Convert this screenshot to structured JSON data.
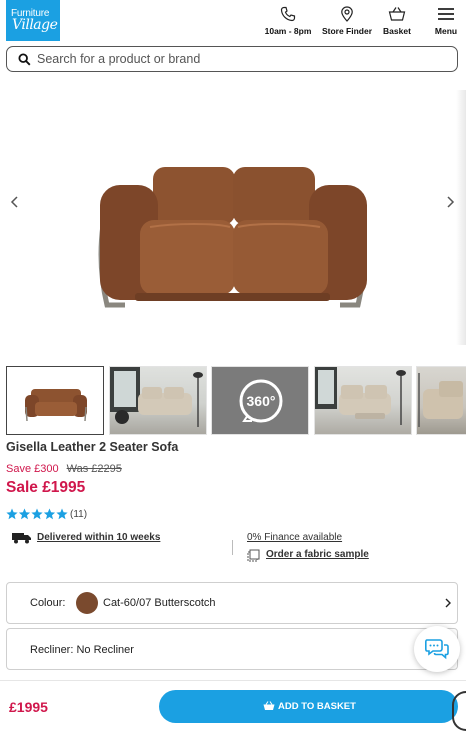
{
  "header": {
    "logo_line1": "Furniture",
    "logo_line2": "Village",
    "nav": [
      {
        "label": "10am - 8pm",
        "icon": "phone-icon"
      },
      {
        "label": "Store Finder",
        "icon": "location-pin-icon"
      },
      {
        "label": "Basket",
        "icon": "basket-icon"
      },
      {
        "label": "Menu",
        "icon": "hamburger-menu-icon"
      }
    ]
  },
  "search": {
    "placeholder": "Search for a product or brand",
    "icon": "search-icon"
  },
  "gallery": {
    "thumbnails": [
      {
        "alt": "Gisella Leather 2 Seater Sofa front view"
      },
      {
        "alt": "Sofa in living room"
      },
      {
        "alt": "360 view",
        "badge": "360°"
      },
      {
        "alt": "Sofa reclined in living room"
      },
      {
        "alt": "Sofa side view"
      }
    ]
  },
  "product": {
    "title": "Gisella Leather 2 Seater Sofa",
    "save": "Save £300",
    "was": "Was £2295",
    "sale": "Sale £1995",
    "rating": 5,
    "review_count": "(11)",
    "delivery": "Delivered within 10 weeks",
    "finance": "0% Finance available",
    "fabric_sample": "Order a fabric sample"
  },
  "options": {
    "colour_label": "Colour:",
    "colour_value": "Cat-60/07 Butterscotch",
    "colour_hex": "#7a4a2e",
    "recliner": "Recliner: No Recliner"
  },
  "bottom": {
    "price": "£1995",
    "add_to_basket": "ADD TO BASKET"
  },
  "colors": {
    "brand_blue": "#1ba0e2",
    "sale_red": "#d0174c"
  }
}
